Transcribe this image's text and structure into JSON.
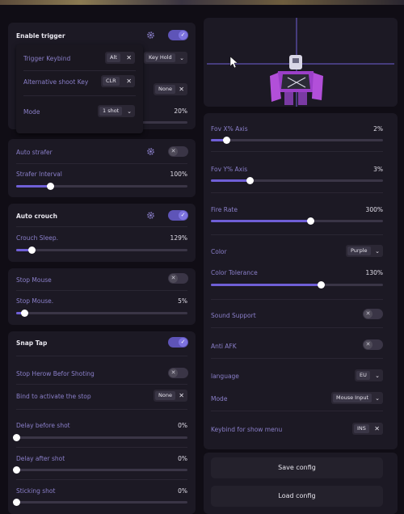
{
  "left": {
    "enable_trigger": {
      "label": "Enable trigger"
    },
    "popup": {
      "trigger_keybind": {
        "label": "Trigger Keybind",
        "key": "Alt"
      },
      "key_mode": "Key Hold",
      "alt_shoot_key": {
        "label": "Alternative shoot Key",
        "key": "CLR"
      },
      "mode": {
        "label": "Mode",
        "value": "1 shot"
      }
    },
    "behind": {
      "none_key": "None",
      "pct": "20%"
    },
    "auto_strafer": {
      "label": "Auto strafer"
    },
    "strafer_interval": {
      "label": "Strafer Interval",
      "value": "100%",
      "level": 0.2
    },
    "auto_crouch": {
      "label": "Auto crouch"
    },
    "crouch_sleep": {
      "label": "Crouch Sleep.",
      "value": "129%",
      "level": 0.09
    },
    "stop_mouse_toggle": {
      "label": "Stop Mouse"
    },
    "stop_mouse_slider": {
      "label": "Stop Mouse.",
      "value": "5%",
      "level": 0.05
    },
    "snap_tap": {
      "label": "Snap Tap"
    },
    "stop_herow": {
      "label": "Stop Herow Befor Shoting"
    },
    "bind_stop": {
      "label": "Bind to activate the stop",
      "key": "None"
    },
    "delay_before": {
      "label": "Delay before shot",
      "value": "0%",
      "level": 0
    },
    "delay_after": {
      "label": "Delay after shot",
      "value": "0%",
      "level": 0
    },
    "sticking": {
      "label": "Sticking shot",
      "value": "0%",
      "level": 0
    }
  },
  "right": {
    "fov_x": {
      "label": "Fov X% Axis",
      "value": "2%",
      "level": 0.09
    },
    "fov_y": {
      "label": "Fov Y% Axis",
      "value": "3%",
      "level": 0.23
    },
    "fire_rate": {
      "label": "Fire Rate",
      "value": "300%",
      "level": 0.58
    },
    "color": {
      "label": "Color",
      "value": "Purple"
    },
    "color_tolerance": {
      "label": "Color Tolerance",
      "value": "130%",
      "level": 0.64
    },
    "sound_support": {
      "label": "Sound Support"
    },
    "anti_afk": {
      "label": "Anti AFK"
    },
    "language": {
      "label": "language",
      "value": "EU"
    },
    "mode": {
      "label": "Mode",
      "value": "Mouse Input"
    },
    "keybind_menu": {
      "label": "Keybind for show menu",
      "key": "INS"
    },
    "save_config": "Save config",
    "load_config": "Load config"
  },
  "colors": {
    "accent": "#6f5fd6",
    "label": "#8a7fc9",
    "panel": "#1c1924",
    "bg": "#100d15"
  }
}
